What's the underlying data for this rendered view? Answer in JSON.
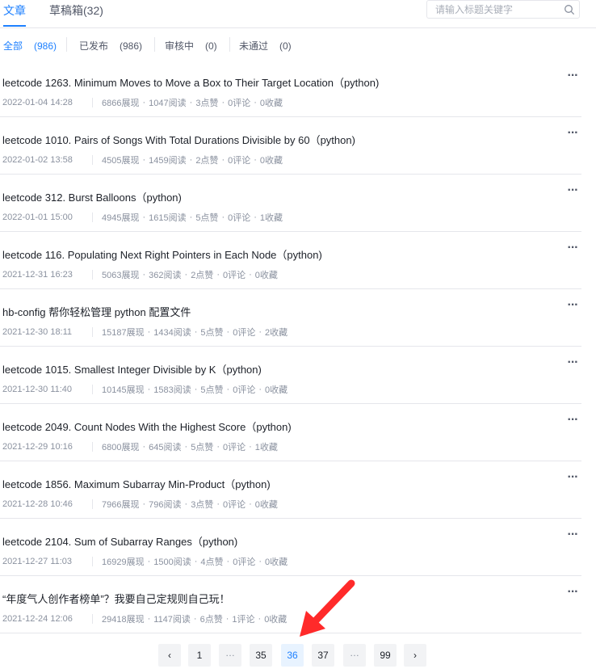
{
  "tabs": [
    {
      "label": "文章"
    },
    {
      "label": "草稿箱(32)"
    }
  ],
  "search": {
    "placeholder": "请输入标题关键字",
    "icon": "search-icon"
  },
  "filters": [
    {
      "label": "全部",
      "count": "(986)"
    },
    {
      "label": "已发布",
      "count": "(986)"
    },
    {
      "label": "审核中",
      "count": "(0)"
    },
    {
      "label": "未通过",
      "count": "(0)"
    }
  ],
  "articles": [
    {
      "title": "leetcode 1263. Minimum Moves to Move a Box to Their Target Location（python)",
      "date": "2022-01-04 14:28",
      "views": "6866展现",
      "reads": "1047阅读",
      "likes": "3点赞",
      "comments": "0评论",
      "favs": "0收藏"
    },
    {
      "title": "leetcode 1010. Pairs of Songs With Total Durations Divisible by 60（python)",
      "date": "2022-01-02 13:58",
      "views": "4505展现",
      "reads": "1459阅读",
      "likes": "2点赞",
      "comments": "0评论",
      "favs": "0收藏"
    },
    {
      "title": "leetcode 312. Burst Balloons（python)",
      "date": "2022-01-01 15:00",
      "views": "4945展现",
      "reads": "1615阅读",
      "likes": "5点赞",
      "comments": "0评论",
      "favs": "1收藏"
    },
    {
      "title": "leetcode 116. Populating Next Right Pointers in Each Node（python)",
      "date": "2021-12-31 16:23",
      "views": "5063展现",
      "reads": "362阅读",
      "likes": "2点赞",
      "comments": "0评论",
      "favs": "0收藏"
    },
    {
      "title": "hb-config 帮你轻松管理 python 配置文件",
      "date": "2021-12-30 18:11",
      "views": "15187展现",
      "reads": "1434阅读",
      "likes": "5点赞",
      "comments": "0评论",
      "favs": "2收藏"
    },
    {
      "title": "leetcode 1015. Smallest Integer Divisible by K（python)",
      "date": "2021-12-30 11:40",
      "views": "10145展现",
      "reads": "1583阅读",
      "likes": "5点赞",
      "comments": "0评论",
      "favs": "0收藏"
    },
    {
      "title": "leetcode 2049. Count Nodes With the Highest Score（python)",
      "date": "2021-12-29 10:16",
      "views": "6800展现",
      "reads": "645阅读",
      "likes": "5点赞",
      "comments": "0评论",
      "favs": "1收藏"
    },
    {
      "title": "leetcode 1856. Maximum Subarray Min-Product（python)",
      "date": "2021-12-28 10:46",
      "views": "7966展现",
      "reads": "796阅读",
      "likes": "3点赞",
      "comments": "0评论",
      "favs": "0收藏"
    },
    {
      "title": "leetcode 2104. Sum of Subarray Ranges（python)",
      "date": "2021-12-27 11:03",
      "views": "16929展现",
      "reads": "1500阅读",
      "likes": "4点赞",
      "comments": "0评论",
      "favs": "0收藏"
    },
    {
      "title": "“年度气人创作者榜单”？我要自己定规则自己玩！",
      "date": "2021-12-24 12:06",
      "views": "29418展现",
      "reads": "1147阅读",
      "likes": "6点赞",
      "comments": "1评论",
      "favs": "0收藏"
    }
  ],
  "meta_separator": "·",
  "more_icon": "more-dots-icon",
  "pagination": {
    "prev": "‹",
    "pages": [
      "1",
      "…",
      "35",
      "36",
      "37",
      "…",
      "99"
    ],
    "current": "36",
    "next": "›"
  },
  "colors": {
    "accent": "#1e80ff",
    "annotation_arrow": "#ff2a2a"
  }
}
